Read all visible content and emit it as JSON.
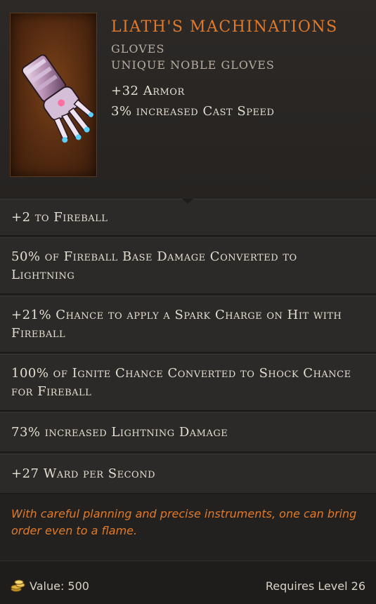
{
  "item": {
    "name": "LIATH'S MACHINATIONS",
    "type": "GLOVES",
    "subtype": "UNIQUE NOBLE GLOVES",
    "implicits": [
      "+32 Armor",
      "3% increased Cast Speed"
    ],
    "affixes": [
      "+2 to Fireball",
      "50% of Fireball Base Damage Converted to Lightning",
      "+21% Chance to apply a Spark Charge on Hit with Fireball",
      "100% of Ignite Chance Converted to Shock Chance for Fireball",
      "73% increased Lightning Damage",
      "+27 Ward per Second"
    ],
    "lore": "With careful planning and precise instruments, one can bring order even to a flame."
  },
  "footer": {
    "value_label": "Value: 500",
    "requirement": "Requires Level 26",
    "coin_icon": "coin-stack-icon"
  },
  "colors": {
    "unique_name": "#e07a2a",
    "lore": "#e07a2a",
    "text": "#e4ddd1",
    "muted": "#b6ada0",
    "background": "#232120"
  }
}
